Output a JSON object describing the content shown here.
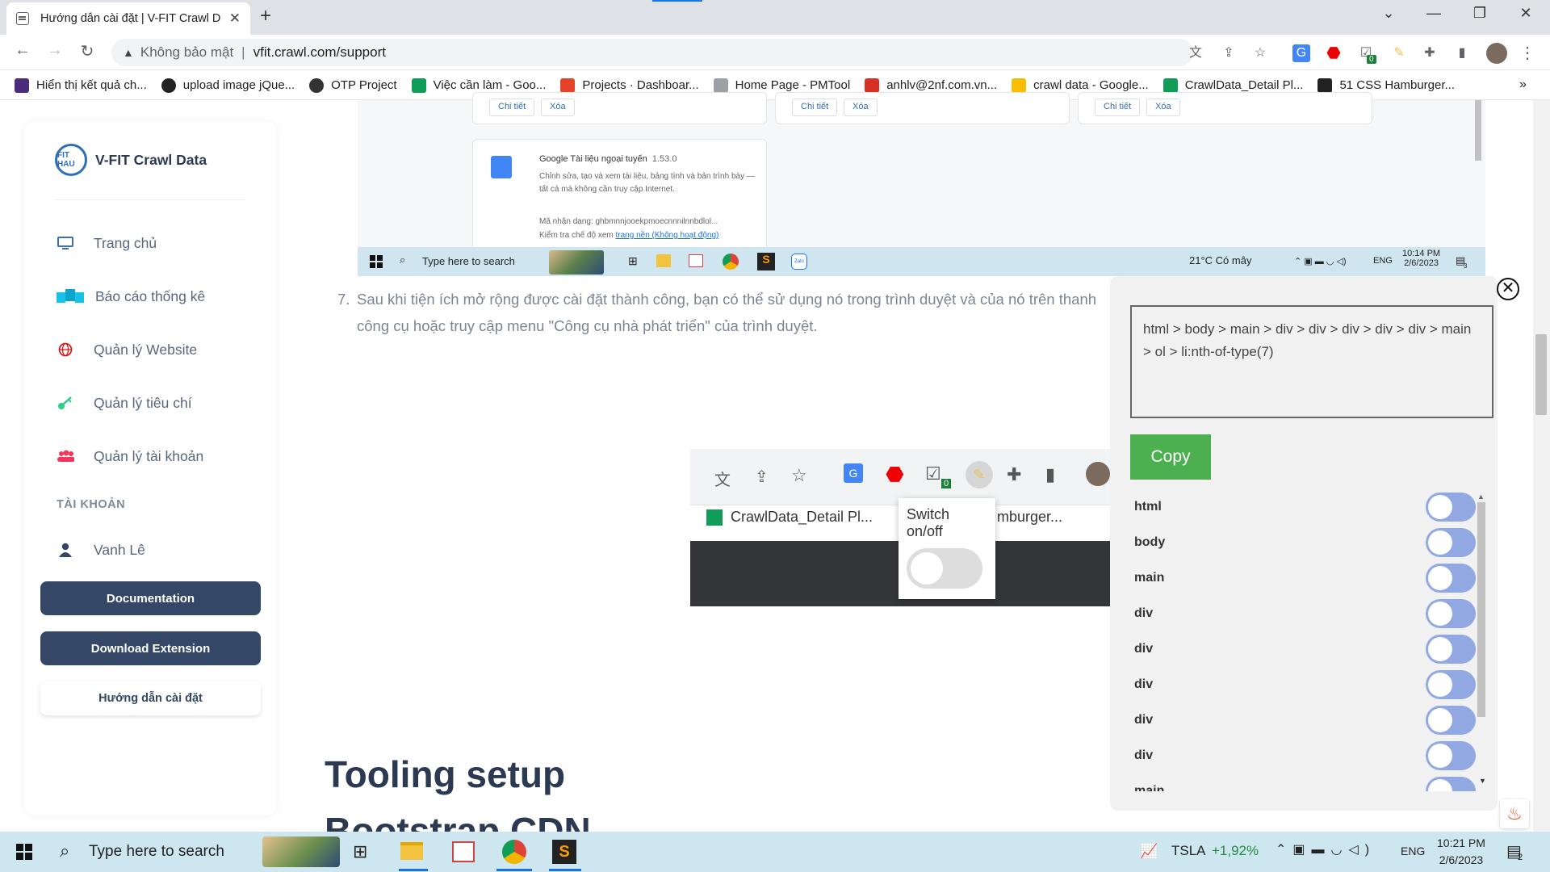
{
  "browser": {
    "tab_title": "Hướng dẫn cài đặt | V-FIT Crawl D",
    "new_tab": "+",
    "address": {
      "security_label": "Không bảo mật",
      "url": "vfit.crawl.com/support"
    },
    "ext_badge": "0",
    "bookmarks": [
      {
        "label": "Hiển thị kết quả ch...",
        "color": "#4a2c7a"
      },
      {
        "label": "upload image jQue...",
        "color": "#222222"
      },
      {
        "label": "OTP Project",
        "color": "#333333"
      },
      {
        "label": "Việc cần làm - Goo...",
        "color": "#0f9d58"
      },
      {
        "label": "Projects · Dashboar...",
        "color": "#e24329"
      },
      {
        "label": "Home Page - PMTool",
        "color": "#9aa0a6"
      },
      {
        "label": "anhlv@2nf.com.vn...",
        "color": "#d93025"
      },
      {
        "label": "crawl data - Google...",
        "color": "#fbbc04"
      },
      {
        "label": "CrawlData_Detail Pl...",
        "color": "#0f9d58"
      },
      {
        "label": "51 CSS Hamburger...",
        "color": "#222222"
      }
    ],
    "more": "»"
  },
  "sidebar": {
    "brand": "V-FIT Crawl Data",
    "logo_text": "FIT HAU",
    "menu": [
      {
        "label": "Trang chủ",
        "icon": "monitor-icon",
        "color": "#3b6fb6"
      },
      {
        "label": "Báo cáo thống kê",
        "icon": "chart-cubes-icon",
        "color": "#17c1e8"
      },
      {
        "label": "Quản lý Website",
        "icon": "globe-icon",
        "color": "#ea0606"
      },
      {
        "label": "Quản lý tiêu chí",
        "icon": "key-icon",
        "color": "#2dce89"
      },
      {
        "label": "Quản lý tài khoản",
        "icon": "users-icon",
        "color": "#f5365c"
      }
    ],
    "account_heading": "TÀI KHOẢN",
    "user": "Vanh Lê",
    "buttons": {
      "documentation": "Documentation",
      "download": "Download Extension",
      "guide": "Hướng dẫn cài đặt"
    }
  },
  "screenshot1": {
    "cards": [
      {
        "detail": "Chi tiết",
        "delete": "Xóa"
      },
      {
        "detail": "Chi tiết",
        "delete": "Xóa"
      },
      {
        "detail": "Chi tiết",
        "delete": "Xóa"
      }
    ],
    "ext_name": "Google Tài liệu ngoại tuyến",
    "ext_version": "1.53.0",
    "ext_desc": "Chỉnh sửa, tạo và xem tài liệu, bảng tính và bản trình bày — tất cả mà không cần truy cập Internet.",
    "ext_id": "Mã nhận dạng: ghbmnnjooekpmoecnnnilnnbdlol...",
    "ext_check_prefix": "Kiểm tra chế độ xem",
    "ext_check_link": "trang nền (Không hoạt động)",
    "taskbar": {
      "search": "Type here to search",
      "weather": "21°C  Có mây",
      "lang": "ENG",
      "time": "10:14 PM",
      "date": "2/6/2023",
      "zalo": "Zalo",
      "notif": "3"
    }
  },
  "step7": {
    "number": "7.",
    "text": "Sau khi tiện ích mở rộng được cài đặt thành công, bạn có thể sử dụng nó trong trình duyệt và của nó trên thanh công cụ hoặc truy cập menu \"Công cụ nhà phát triển\" của trình duyệt."
  },
  "screenshot2": {
    "bookmark": "CrawlData_Detail Pl...",
    "bookmark2": "mburger...",
    "badge": "0",
    "switch_label": "Switch on/off",
    "switch_state": "off"
  },
  "headings": {
    "tooling": "Tooling setup",
    "bootstrap": "Bootstrap CDN"
  },
  "extension_panel": {
    "close": "⊗",
    "selector": "html > body > main > div > div > div > div > div > main > ol > li:nth-of-type(7)",
    "copy": "Copy",
    "tags": [
      "html",
      "body",
      "main",
      "div",
      "div",
      "div",
      "div",
      "div",
      "main"
    ],
    "toggle_color": "#92a8e2"
  },
  "taskbar": {
    "search": "Type here to search",
    "stock_name": "TSLA",
    "stock_change": "+1,92%",
    "lang": "ENG",
    "time": "10:21 PM",
    "date": "2/6/2023",
    "notif": "2"
  }
}
